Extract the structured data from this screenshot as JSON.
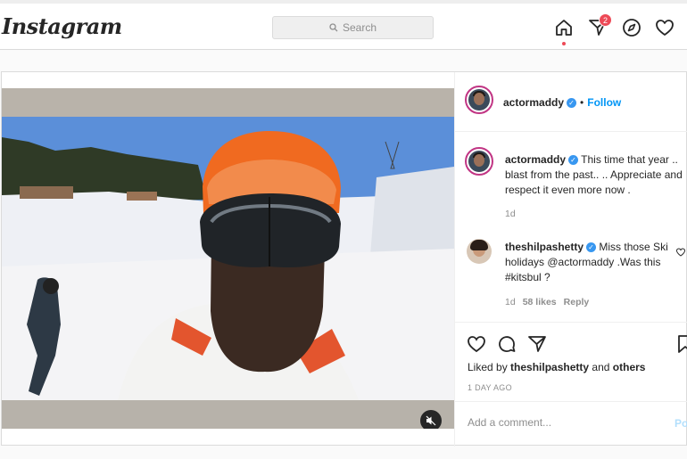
{
  "app": {
    "logo": "Instagram"
  },
  "search": {
    "placeholder": "Search"
  },
  "nav": {
    "notification_count": "2"
  },
  "post": {
    "author": "actormaddy",
    "follow_label": "Follow",
    "dot": "•",
    "caption": "This time that year .. blast from the past.. .. Appreciate and respect it even more now .",
    "caption_age": "1d",
    "comment": {
      "author": "theshilpashetty",
      "text": "Miss those Ski holidays @actormaddy .Was this #kitsbul ?",
      "age": "1d",
      "likes": "58 likes",
      "reply_label": "Reply"
    },
    "liked_by_prefix": "Liked by",
    "liked_by_user": "theshilpashetty",
    "liked_by_and": "and",
    "liked_by_others": "others",
    "time_ago": "1 DAY AGO",
    "add_comment_placeholder": "Add a comment...",
    "post_label": "Post"
  },
  "colors": {
    "accent": "#0095f6",
    "badge": "#ed4956",
    "verified": "#3897f0"
  }
}
